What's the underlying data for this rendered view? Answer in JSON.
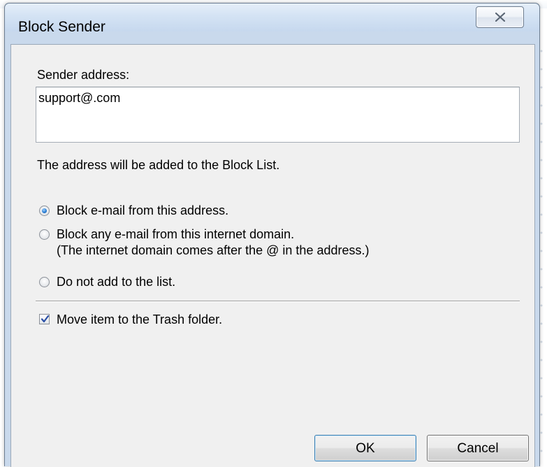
{
  "window": {
    "title": "Block Sender",
    "close_icon": "close-icon"
  },
  "form": {
    "sender_label": "Sender address:",
    "sender_value": "support@.com",
    "info_text": "The address will be added to the Block List.",
    "options": [
      {
        "label": "Block e-mail from this address.",
        "checked": true
      },
      {
        "label": "Block any e-mail from this internet domain.",
        "note": "(The internet domain comes after the @ in the address.)",
        "checked": false
      },
      {
        "label": "Do not add to the list.",
        "checked": false
      }
    ],
    "move_label": "Move item to the Trash folder.",
    "move_checked": true
  },
  "buttons": {
    "ok": "OK",
    "cancel": "Cancel"
  },
  "colors": {
    "frame": "#c9d9ec",
    "client": "#f0f0f0",
    "radio_accent": "#2b7fd3"
  }
}
